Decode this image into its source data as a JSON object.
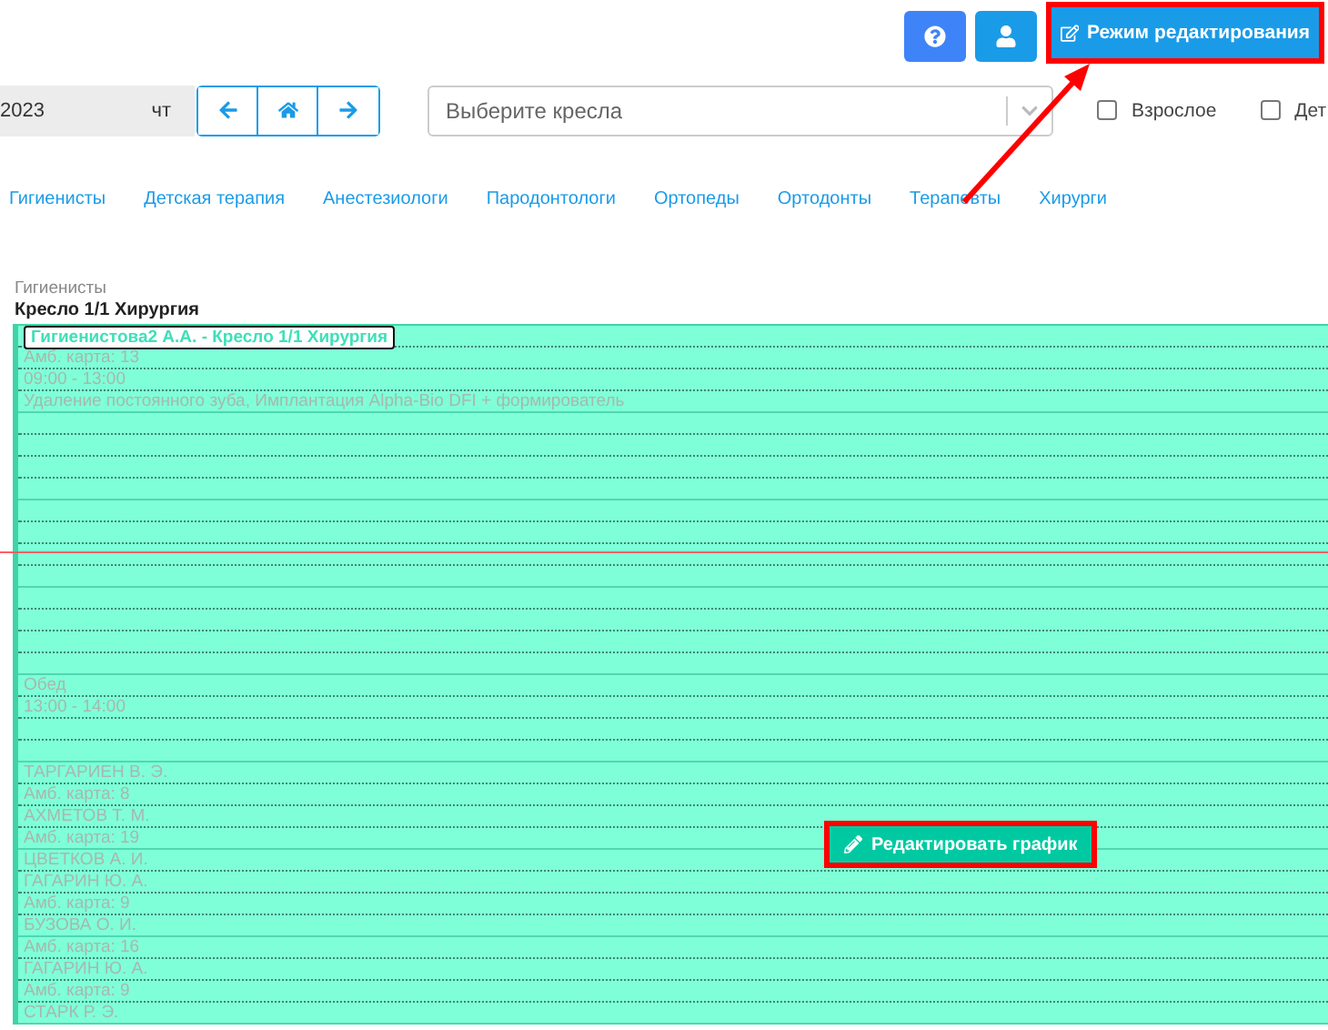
{
  "header_buttons": [
    {
      "kind": "help"
    },
    {
      "kind": "user"
    },
    {
      "kind": "edit_mode",
      "label": "Режим редактирования",
      "highlighted": true
    }
  ],
  "date_field": {
    "value": "2023",
    "weekday": "чт"
  },
  "nav_buttons": [
    {
      "kind": "prev"
    },
    {
      "kind": "home"
    },
    {
      "kind": "next"
    }
  ],
  "chair_select": {
    "placeholder": "Выберите кресла"
  },
  "filters": [
    {
      "label": "Взрослое",
      "checked": false
    },
    {
      "label": "Дет",
      "checked": false
    }
  ],
  "specialty_tabs": [
    {
      "label": "Гигиенисты",
      "selected": false
    },
    {
      "label": "Детская терапия",
      "selected": false
    },
    {
      "label": "Анестезиологи",
      "selected": false
    },
    {
      "label": "Пародонтологи",
      "selected": false
    },
    {
      "label": "Ортопеды",
      "selected": false
    },
    {
      "label": "Ортодонты",
      "selected": false
    },
    {
      "label": "Терапевты",
      "selected": false
    },
    {
      "label": "Хирурги",
      "selected": false
    }
  ],
  "schedule": {
    "group": "Гигиенисты",
    "chair": "Кресло 1/1 Хирургия",
    "current_time_line": true,
    "slots": [
      {
        "kind": "title",
        "text": "Гигиенистова2 А.А. - Кресло 1/1 Хирургия"
      },
      {
        "kind": "text",
        "text": "Амб. карта: 13"
      },
      {
        "kind": "text",
        "text": "09:00 - 13:00"
      },
      {
        "kind": "text",
        "text": "Удаление постоянного зуба, Имплантация Alpha-Bio DFI + формирователь"
      },
      {
        "kind": "empty"
      },
      {
        "kind": "empty"
      },
      {
        "kind": "empty"
      },
      {
        "kind": "empty"
      },
      {
        "kind": "empty"
      },
      {
        "kind": "empty"
      },
      {
        "kind": "empty"
      },
      {
        "kind": "empty"
      },
      {
        "kind": "empty"
      },
      {
        "kind": "empty"
      },
      {
        "kind": "empty"
      },
      {
        "kind": "empty"
      },
      {
        "kind": "text",
        "text": "Обед"
      },
      {
        "kind": "text",
        "text": "13:00 - 14:00"
      },
      {
        "kind": "empty"
      },
      {
        "kind": "empty"
      },
      {
        "kind": "text",
        "text": "ТАРГАРИЕН В. Э."
      },
      {
        "kind": "text",
        "text": "Амб. карта: 8"
      },
      {
        "kind": "text",
        "text": "АХМЕТОВ Т. М."
      },
      {
        "kind": "text",
        "text": "Амб. карта: 19"
      },
      {
        "kind": "text",
        "text": "ЦВЕТКОВ А. И."
      },
      {
        "kind": "text",
        "text": "ГАГАРИН Ю. А."
      },
      {
        "kind": "text",
        "text": "Амб. карта: 9"
      },
      {
        "kind": "text",
        "text": "БУЗОВА О. И."
      },
      {
        "kind": "text",
        "text": "Амб. карта: 16"
      },
      {
        "kind": "text",
        "text": "ГАГАРИН Ю. А."
      },
      {
        "kind": "text",
        "text": "Амб. карта: 9"
      },
      {
        "kind": "text",
        "text": "СТАРК Р. Э."
      }
    ]
  },
  "edit_schedule_button": {
    "label": "Редактировать график",
    "highlighted": true
  },
  "annotation_arrow": true
}
